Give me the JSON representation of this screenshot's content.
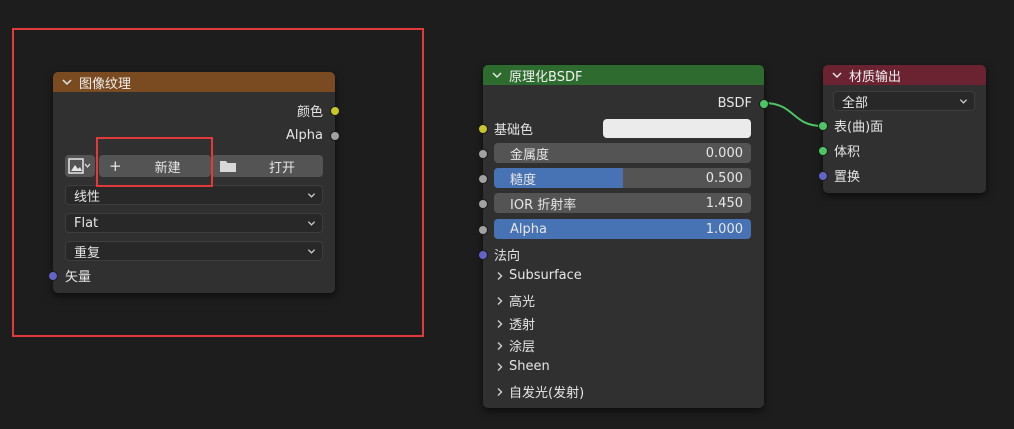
{
  "image_texture_node": {
    "title": "图像纹理",
    "header_color": "#7a4a20",
    "outputs": {
      "color": "颜色",
      "alpha": "Alpha"
    },
    "new_label": "新建",
    "new_plus": "+",
    "open_label": "打开",
    "interpolation": "线性",
    "projection": "Flat",
    "extension": "重复",
    "input_vector": "矢量"
  },
  "principled_node": {
    "title": "原理化BSDF",
    "header_color": "#2e6b2e",
    "output_bsdf": "BSDF",
    "base_color_label": "基础色",
    "base_color_swatch": "#ebebeb",
    "metallic": {
      "label": "金属度",
      "value": "0.000",
      "fraction": 0.0
    },
    "roughness": {
      "label": "糙度",
      "value": "0.500",
      "fraction": 0.5
    },
    "ior": {
      "label": "IOR 折射率",
      "value": "1.450"
    },
    "alpha": {
      "label": "Alpha",
      "value": "1.000",
      "fraction": 1.0
    },
    "normal_label": "法向",
    "panels": [
      "Subsurface",
      "高光",
      "透射",
      "涂层",
      "Sheen",
      "自发光(发射)"
    ]
  },
  "material_output_node": {
    "title": "材质输出",
    "header_color": "#6b2231",
    "target": "全部",
    "inputs": {
      "surface": "表(曲)面",
      "volume": "体积",
      "displacement": "置换"
    }
  },
  "colors": {
    "annotation_red": "#e03a3a",
    "link_green": "#4ec466",
    "slider_blue": "#4772b3"
  }
}
